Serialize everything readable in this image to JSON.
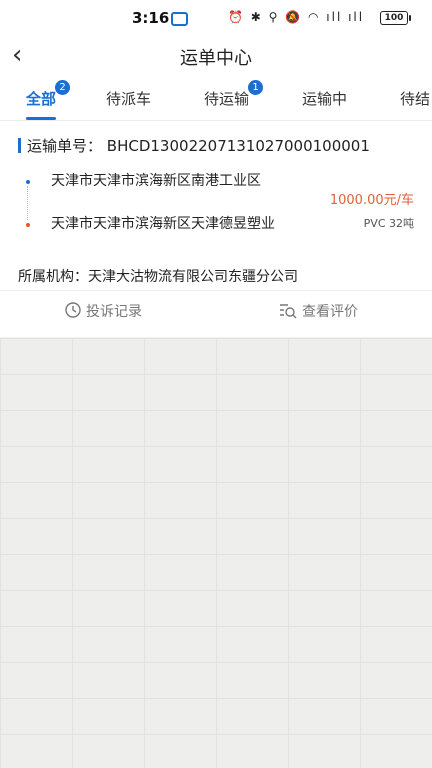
{
  "status_bar": {
    "time": "3:16",
    "battery": "100"
  },
  "header": {
    "title": "运单中心"
  },
  "tabs": [
    {
      "label": "全部",
      "badge": "2",
      "active": true
    },
    {
      "label": "待派车",
      "badge": null,
      "active": false
    },
    {
      "label": "待运输",
      "badge": "1",
      "active": false
    },
    {
      "label": "运输中",
      "badge": null,
      "active": false
    },
    {
      "label": "待结",
      "badge": null,
      "active": false
    }
  ],
  "order": {
    "number_label": "运输单号：",
    "number": "BHCD13002207131027000100001",
    "origin": "天津市天津市滨海新区南港工业区",
    "destination": "天津市天津市滨海新区天津德昱塑业",
    "price": "1000.00元/车",
    "cargo": "PVC  32吨",
    "org_label": "所属机构：",
    "org": "天津大沽物流有限公司东疆分公司"
  },
  "actions": {
    "complaint": "投诉记录",
    "review": "查看评价"
  },
  "colors": {
    "accent": "#1a6fd0",
    "price": "#e2603a",
    "destination_dot": "#e6562b"
  }
}
